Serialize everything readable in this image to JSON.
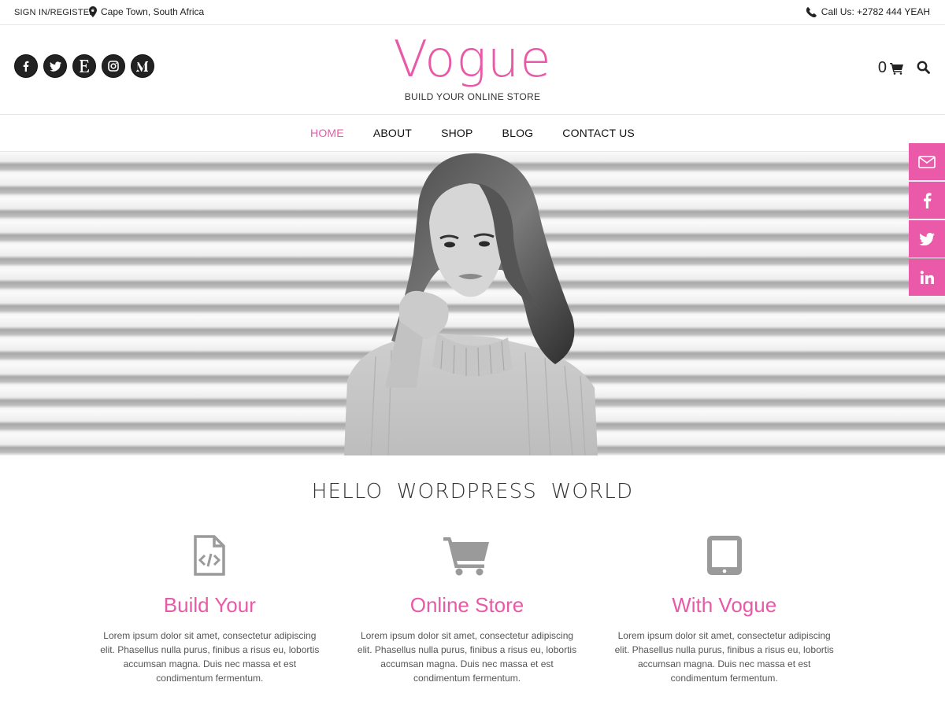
{
  "topbar": {
    "signin": "SIGN IN/REGISTER",
    "location": "Cape Town, South Africa",
    "call": "Call Us: +2782 444 YEAH"
  },
  "header": {
    "social_icons": [
      "facebook-icon",
      "twitter-icon",
      "etsy-icon",
      "instagram-icon",
      "medium-icon"
    ],
    "logo": "Vogue",
    "tagline": "BUILD YOUR ONLINE STORE",
    "cart_count": "0"
  },
  "nav": {
    "items": [
      "HOME",
      "ABOUT",
      "SHOP",
      "BLOG",
      "CONTACT US"
    ],
    "active": "HOME"
  },
  "share": [
    "mail-icon",
    "facebook-icon",
    "twitter-icon",
    "linkedin-icon"
  ],
  "colors": {
    "accent": "#e85aa8",
    "share_bg": "#ea5aa9",
    "text": "#333333",
    "icon_gray": "#9a9a9a"
  },
  "content": {
    "heading": "HELLO  WORDPRESS  WORLD",
    "features": [
      {
        "icon": "code-file-icon",
        "title": "Build Your",
        "text": "Lorem ipsum dolor sit amet, consectetur adipiscing elit. Phasellus nulla purus, finibus a risus eu, lobortis accumsan magna. Duis nec massa et est condimentum fermentum."
      },
      {
        "icon": "cart-icon",
        "title": "Online Store",
        "text": "Lorem ipsum dolor sit amet, consectetur adipiscing elit. Phasellus nulla purus, finibus a risus eu, lobortis accumsan magna. Duis nec massa et est condimentum fermentum."
      },
      {
        "icon": "tablet-icon",
        "title": "With Vogue",
        "text": "Lorem ipsum dolor sit amet, consectetur adipiscing elit. Phasellus nulla purus, finibus a risus eu, lobortis accumsan magna. Duis nec massa et est condimentum fermentum."
      }
    ]
  }
}
